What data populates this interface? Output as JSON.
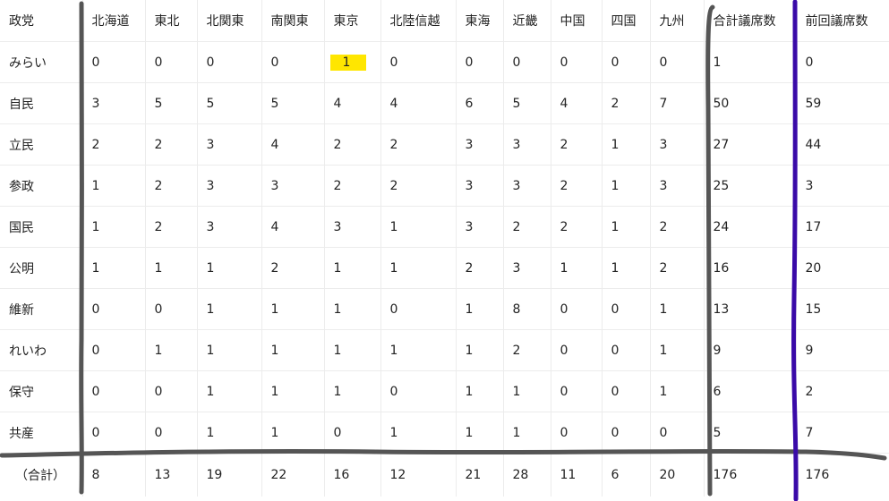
{
  "table": {
    "header_party": "政党",
    "regions": [
      "北海道",
      "東北",
      "北関東",
      "南関東",
      "東京",
      "北陸信越",
      "東海",
      "近畿",
      "中国",
      "四国",
      "九州"
    ],
    "header_total": "合計議席数",
    "header_previous": "前回議席数",
    "rows": [
      {
        "party": "みらい",
        "values": [
          "0",
          "0",
          "0",
          "0",
          "1",
          "0",
          "0",
          "0",
          "0",
          "0",
          "0"
        ],
        "total": "1",
        "previous": "0"
      },
      {
        "party": "自民",
        "values": [
          "3",
          "5",
          "5",
          "5",
          "4",
          "4",
          "6",
          "5",
          "4",
          "2",
          "7"
        ],
        "total": "50",
        "previous": "59"
      },
      {
        "party": "立民",
        "values": [
          "2",
          "2",
          "3",
          "4",
          "2",
          "2",
          "3",
          "3",
          "2",
          "1",
          "3"
        ],
        "total": "27",
        "previous": "44"
      },
      {
        "party": "参政",
        "values": [
          "1",
          "2",
          "3",
          "3",
          "2",
          "2",
          "3",
          "3",
          "2",
          "1",
          "3"
        ],
        "total": "25",
        "previous": "3"
      },
      {
        "party": "国民",
        "values": [
          "1",
          "2",
          "3",
          "4",
          "3",
          "1",
          "3",
          "2",
          "2",
          "1",
          "2"
        ],
        "total": "24",
        "previous": "17"
      },
      {
        "party": "公明",
        "values": [
          "1",
          "1",
          "1",
          "2",
          "1",
          "1",
          "2",
          "3",
          "1",
          "1",
          "2"
        ],
        "total": "16",
        "previous": "20"
      },
      {
        "party": "維新",
        "values": [
          "0",
          "0",
          "1",
          "1",
          "1",
          "0",
          "1",
          "8",
          "0",
          "0",
          "1"
        ],
        "total": "13",
        "previous": "15"
      },
      {
        "party": "れいわ",
        "values": [
          "0",
          "1",
          "1",
          "1",
          "1",
          "1",
          "1",
          "2",
          "0",
          "0",
          "1"
        ],
        "total": "9",
        "previous": "9"
      },
      {
        "party": "保守",
        "values": [
          "0",
          "0",
          "1",
          "1",
          "1",
          "0",
          "1",
          "1",
          "0",
          "0",
          "1"
        ],
        "total": "6",
        "previous": "2"
      },
      {
        "party": "共産",
        "values": [
          "0",
          "0",
          "1",
          "1",
          "0",
          "1",
          "1",
          "1",
          "0",
          "0",
          "0"
        ],
        "total": "5",
        "previous": "7"
      }
    ],
    "total_row": {
      "label": "（合計）",
      "values": [
        "8",
        "13",
        "19",
        "22",
        "16",
        "12",
        "21",
        "28",
        "11",
        "6",
        "20"
      ],
      "total": "176",
      "previous": "176"
    },
    "highlight": {
      "row": 0,
      "region": "東京",
      "color": "#ffe600"
    }
  },
  "annotations": {
    "dark_lines_color": "#555555",
    "purple_line_color": "#3a0aa8"
  }
}
